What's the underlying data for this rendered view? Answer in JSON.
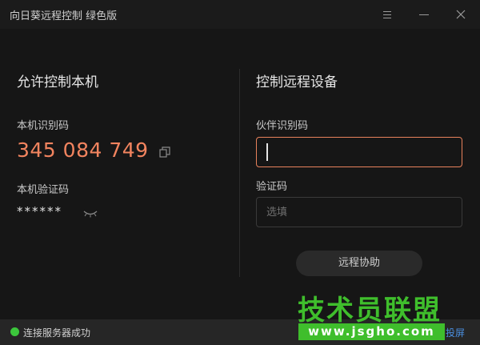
{
  "window": {
    "title": "向日葵远程控制 绿色版"
  },
  "icons": {
    "menu": "hamburger-menu-icon",
    "minimize": "minimize-icon",
    "close": "close-icon",
    "copy": "copy-icon",
    "visibility": "eye-closed-icon"
  },
  "left": {
    "title": "允许控制本机",
    "id_label": "本机识别码",
    "id_value": "345 084 749",
    "code_label": "本机验证码",
    "code_value": "******"
  },
  "right": {
    "title": "控制远程设备",
    "partner_label": "伙伴识别码",
    "partner_value": "",
    "code_label": "验证码",
    "code_placeholder": "选填",
    "assist_button": "远程协助"
  },
  "status": {
    "text": "连接服务器成功",
    "right_link": "投屏",
    "indicator_color": "#3cc63c"
  },
  "watermark": {
    "title": "技术员联盟",
    "url": "www.jsgho.com"
  },
  "colors": {
    "accent": "#f2845f",
    "input_focus_border": "#e8825c",
    "watermark_green": "#3fbe2c"
  }
}
